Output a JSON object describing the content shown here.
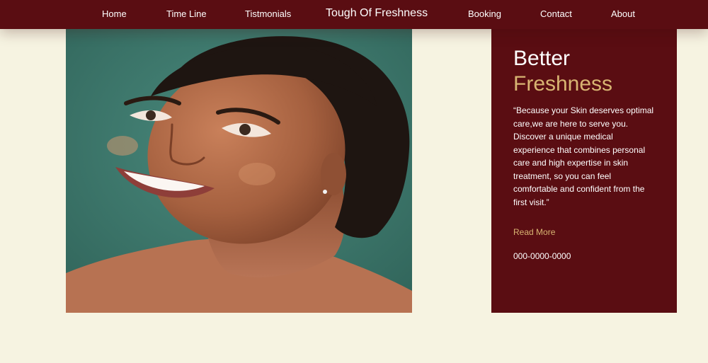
{
  "nav": {
    "items": [
      "Home",
      "Time Line",
      "Tistmonials",
      "Booking",
      "Contact",
      "About"
    ],
    "brand": "Tough Of Freshness"
  },
  "hero": {
    "title_line1": "Better",
    "title_line2": "Freshness",
    "quote": "“Because your Skin deserves optimal care,we are here to serve you. Discover a unique medical experience that combines personal care and high expertise in skin treatment, so you can feel comfortable and confident from the first visit.”",
    "read_more": "Read More",
    "phone": "000-0000-0000"
  },
  "colors": {
    "nav_background": "#5a0d12",
    "page_background": "#f6f3e1",
    "accent_gold": "#d8b472",
    "photo_background": "#3e7b6f"
  }
}
